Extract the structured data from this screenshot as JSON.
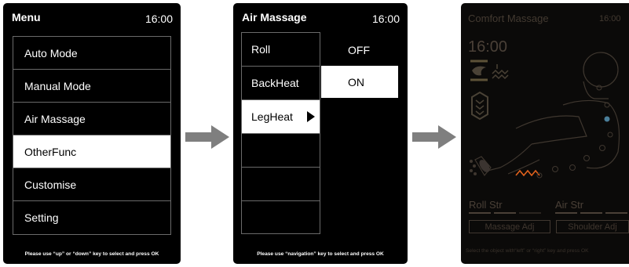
{
  "menu_screen": {
    "title": "Menu",
    "time": "16:00",
    "items": [
      {
        "label": "Auto Mode"
      },
      {
        "label": "Manual Mode"
      },
      {
        "label": "Air Massage"
      },
      {
        "label": "OtherFunc"
      },
      {
        "label": "Customise"
      },
      {
        "label": "Setting"
      }
    ],
    "selected_index": 3,
    "footer": "Please use “up” or “down” key to select and press OK"
  },
  "air_massage_screen": {
    "title": "Air Massage",
    "time": "16:00",
    "items": [
      {
        "label": "Roll"
      },
      {
        "label": "BackHeat"
      },
      {
        "label": "LegHeat"
      },
      {
        "label": ""
      },
      {
        "label": ""
      },
      {
        "label": ""
      }
    ],
    "selected_index": 2,
    "options": [
      {
        "label": "OFF",
        "selected": false
      },
      {
        "label": "ON",
        "selected": true
      }
    ],
    "footer": "Please use “navigation” key to select and press OK"
  },
  "comfort_massage_screen": {
    "title": "Comfort Massage",
    "header_time": "16:00",
    "clock": "16:00",
    "roll_strength_label": "Roll Str",
    "air_strength_label": "Air Str",
    "massage_adj_button": "Massage Adj",
    "shoulder_adj_button": "Shoulder Adj",
    "footer": "Select the object with“left” or “right” key and press OK",
    "icons": [
      "roller-icon",
      "heat-wave-icon",
      "airbag-icon",
      "foot-roller-icon",
      "body-figure-icon"
    ],
    "colors": {
      "highlight_heat": "#e2621c",
      "highlight_dot": "#4a7e99",
      "dim_text": "#433a31"
    }
  },
  "flow_arrows": [
    "arrow-right-icon",
    "arrow-right-icon"
  ]
}
